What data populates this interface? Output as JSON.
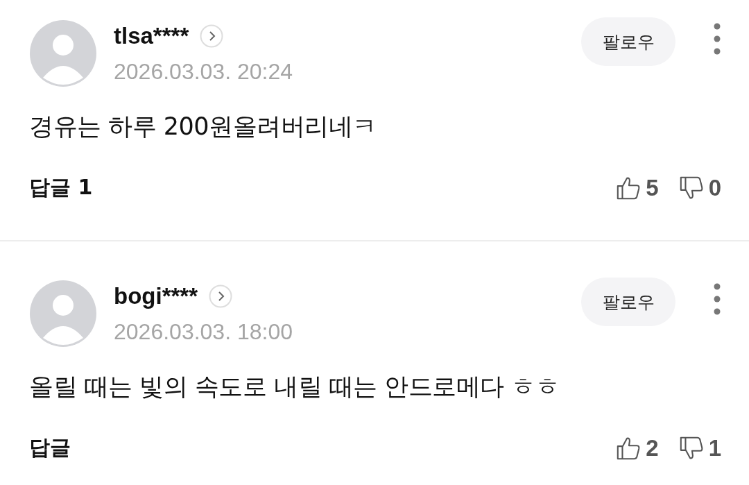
{
  "comments": [
    {
      "username": "tlsa****",
      "date": "2026.03.03. 20:24",
      "follow": "팔로우",
      "text": "경유는 하루 200원올려버리네ㅋ",
      "reply_label": "답글",
      "reply_count": "1",
      "likes": "5",
      "dislikes": "0"
    },
    {
      "username": "bogi****",
      "date": "2026.03.03. 18:00",
      "follow": "팔로우",
      "text": "올릴 때는 빛의 속도로 내릴 때는 안드로메다 ㅎㅎ",
      "reply_label": "답글",
      "likes": "2",
      "dislikes": "1"
    }
  ]
}
